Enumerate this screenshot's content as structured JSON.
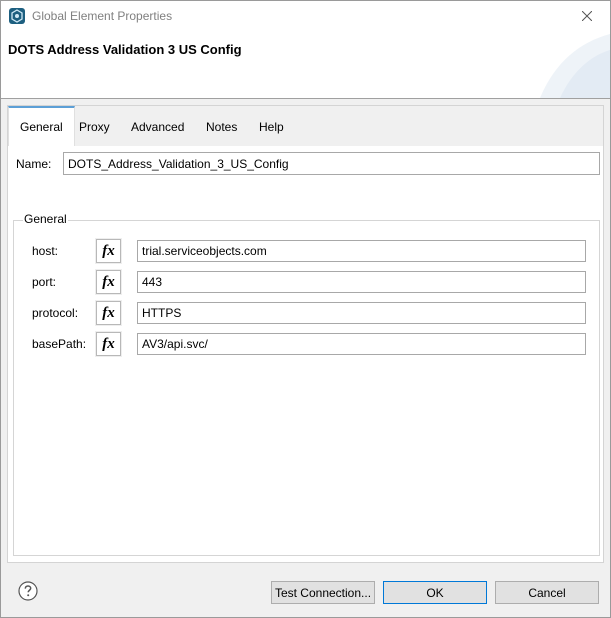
{
  "window": {
    "title": "Global Element Properties",
    "banner_title": "DOTS Address Validation 3 US Config"
  },
  "tabs": [
    {
      "label": "General",
      "active": true
    },
    {
      "label": "Proxy",
      "active": false
    },
    {
      "label": "Advanced",
      "active": false
    },
    {
      "label": "Notes",
      "active": false
    },
    {
      "label": "Help",
      "active": false
    }
  ],
  "general": {
    "name_label": "Name:",
    "name_value": "DOTS_Address_Validation_3_US_Config",
    "group_title": "General",
    "fx_label": "fx",
    "fields": [
      {
        "label": "host:",
        "value": "trial.serviceobjects.com"
      },
      {
        "label": "port:",
        "value": "443"
      },
      {
        "label": "protocol:",
        "value": "HTTPS"
      },
      {
        "label": "basePath:",
        "value": "AV3/api.svc/"
      }
    ]
  },
  "footer": {
    "test_connection": "Test Connection...",
    "ok": "OK",
    "cancel": "Cancel"
  },
  "colors": {
    "accent": "#0078d7",
    "tab_accent": "#5c9fd6"
  }
}
